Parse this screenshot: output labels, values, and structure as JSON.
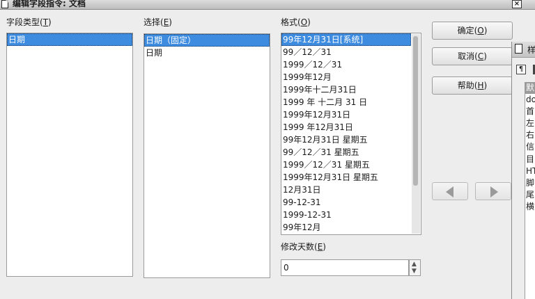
{
  "window": {
    "title": "编辑字段指令: 文档",
    "close_glyph": "×"
  },
  "field_type": {
    "label_text": "字段类型",
    "label_mnemonic": "T",
    "items": [
      "日期"
    ]
  },
  "selection": {
    "label_text": "选择",
    "label_mnemonic": "E",
    "items": [
      "日期（固定）",
      "日期"
    ]
  },
  "format": {
    "label_text": "格式",
    "label_mnemonic": "O",
    "items": [
      "99年12月31日[系统]",
      "99／12／31",
      "1999／12／31",
      "1999年12月",
      "1999年十二月31日",
      "1999 年 十二月 31 日",
      "1999年12月31日",
      "1999 年12月31日",
      "99年12月31日 星期五",
      "99／12／31 星期五",
      "1999／12／31 星期五",
      "1999年12月31日 星期五",
      "12月31日",
      "99-12-31",
      "1999-12-31",
      "99年12月"
    ]
  },
  "offset": {
    "label_text": "修改天数",
    "label_mnemonic": "E",
    "value": "0"
  },
  "buttons": {
    "ok": {
      "text": "确定",
      "mnemonic": "O"
    },
    "cancel": {
      "text": "取消",
      "mnemonic": "C"
    },
    "help": {
      "text": "帮助",
      "mnemonic": "H"
    }
  },
  "side_panel": {
    "title": "样",
    "items": [
      "默",
      "do",
      "首",
      "左",
      "右",
      "信",
      "目",
      "HT",
      "脚",
      "尾",
      "横"
    ]
  },
  "colors": {
    "selection": "#3e8ce0",
    "background": "#ededed"
  }
}
